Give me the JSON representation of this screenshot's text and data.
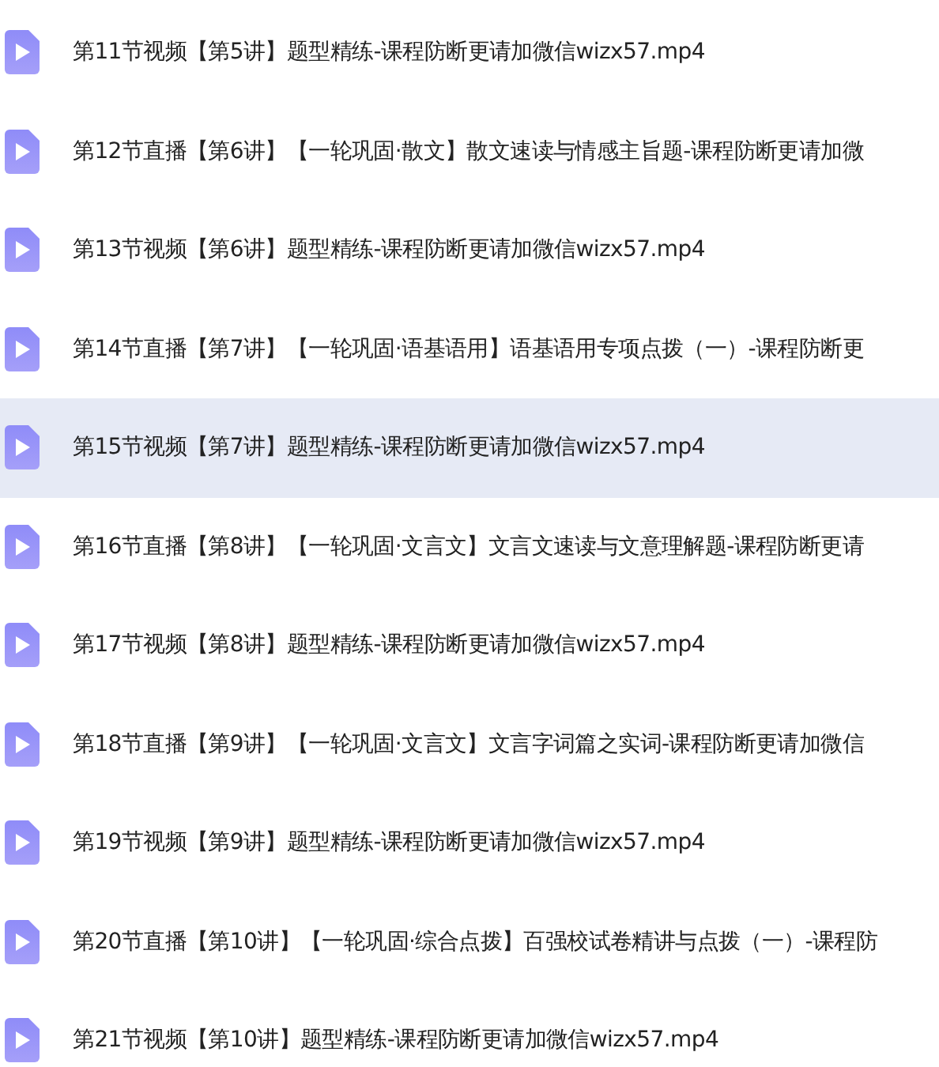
{
  "files": [
    {
      "name": "第11节视频【第5讲】题型精练-课程防断更请加微信wizx57.mp4",
      "selected": false
    },
    {
      "name": "第12节直播【第6讲】【一轮巩固·散文】散文速读与情感主旨题-课程防断更请加微",
      "selected": false
    },
    {
      "name": "第13节视频【第6讲】题型精练-课程防断更请加微信wizx57.mp4",
      "selected": false
    },
    {
      "name": "第14节直播【第7讲】【一轮巩固·语基语用】语基语用专项点拨（一）-课程防断更",
      "selected": false
    },
    {
      "name": "第15节视频【第7讲】题型精练-课程防断更请加微信wizx57.mp4",
      "selected": true
    },
    {
      "name": "第16节直播【第8讲】【一轮巩固·文言文】文言文速读与文意理解题-课程防断更请",
      "selected": false
    },
    {
      "name": "第17节视频【第8讲】题型精练-课程防断更请加微信wizx57.mp4",
      "selected": false
    },
    {
      "name": "第18节直播【第9讲】【一轮巩固·文言文】文言字词篇之实词-课程防断更请加微信",
      "selected": false
    },
    {
      "name": "第19节视频【第9讲】题型精练-课程防断更请加微信wizx57.mp4",
      "selected": false
    },
    {
      "name": "第20节直播【第10讲】【一轮巩固·综合点拨】百强校试卷精讲与点拨（一）-课程防",
      "selected": false
    },
    {
      "name": "第21节视频【第10讲】题型精练-课程防断更请加微信wizx57.mp4",
      "selected": false
    }
  ]
}
